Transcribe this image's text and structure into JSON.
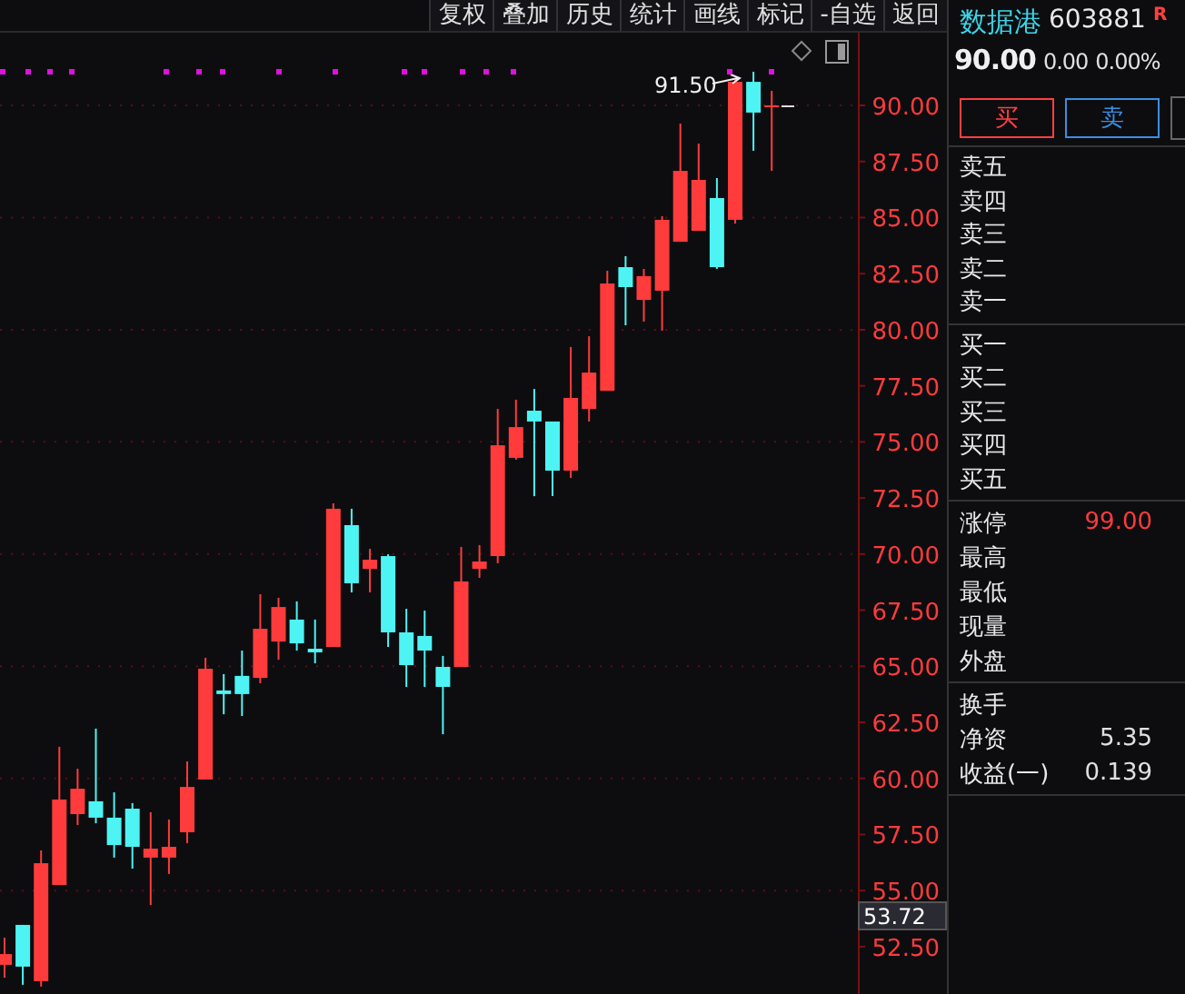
{
  "toolbar": {
    "buttons": [
      "复权",
      "叠加",
      "历史",
      "统计",
      "画线",
      "标记",
      "-自选",
      "返回"
    ]
  },
  "chart": {
    "high_marker": "91.50",
    "cursor_price": "53.72",
    "chart_data": {
      "type": "candlestick",
      "ylim": [
        50.39,
        93.24
      ],
      "grid": true,
      "yticks": [
        {
          "value": 90,
          "label": "90.00"
        },
        {
          "value": 87.5,
          "label": "87.50"
        },
        {
          "value": 85,
          "label": "85.00"
        },
        {
          "value": 82.5,
          "label": "82.50"
        },
        {
          "value": 80,
          "label": "80.00"
        },
        {
          "value": 77.5,
          "label": "77.50"
        },
        {
          "value": 75,
          "label": "75.00"
        },
        {
          "value": 72.5,
          "label": "72.50"
        },
        {
          "value": 70,
          "label": "70.00"
        },
        {
          "value": 67.5,
          "label": "67.50"
        },
        {
          "value": 65,
          "label": "65.00"
        },
        {
          "value": 62.5,
          "label": "62.50"
        },
        {
          "value": 60,
          "label": "60.00"
        },
        {
          "value": 57.5,
          "label": "57.50"
        },
        {
          "value": 55,
          "label": "55.00"
        },
        {
          "value": 52.5,
          "label": "52.50"
        }
      ],
      "ohlc": [
        [
          51.69,
          52.9,
          51.12,
          52.17
        ],
        [
          53.47,
          53.47,
          50.8,
          51.61
        ],
        [
          50.96,
          56.79,
          50.72,
          56.22
        ],
        [
          55.25,
          61.41,
          55.25,
          59.06
        ],
        [
          58.41,
          60.43,
          57.92,
          59.54
        ],
        [
          58.98,
          62.22,
          58.0,
          58.25
        ],
        [
          58.25,
          59.38,
          56.47,
          57.03
        ],
        [
          58.65,
          58.9,
          55.98,
          56.95
        ],
        [
          56.47,
          58.49,
          54.36,
          56.87
        ],
        [
          56.47,
          58.17,
          55.74,
          56.95
        ],
        [
          57.6,
          60.76,
          57.11,
          59.62
        ],
        [
          59.95,
          65.38,
          59.95,
          64.89
        ],
        [
          63.92,
          64.65,
          62.86,
          63.76
        ],
        [
          64.57,
          65.7,
          62.78,
          63.76
        ],
        [
          64.48,
          68.21,
          64.24,
          66.67
        ],
        [
          66.1,
          68.05,
          65.29,
          67.64
        ],
        [
          67.08,
          67.89,
          65.7,
          66.02
        ],
        [
          65.78,
          67.08,
          65.13,
          65.62
        ],
        [
          65.86,
          72.26,
          65.86,
          72.02
        ],
        [
          71.29,
          72.02,
          68.29,
          68.7
        ],
        [
          69.34,
          70.24,
          68.29,
          69.75
        ],
        [
          69.91,
          69.99,
          65.86,
          66.51
        ],
        [
          66.51,
          67.56,
          64.08,
          65.05
        ],
        [
          66.35,
          67.48,
          64.08,
          65.7
        ],
        [
          64.97,
          65.46,
          61.97,
          64.08
        ],
        [
          64.97,
          70.32,
          64.97,
          68.78
        ],
        [
          69.34,
          70.4,
          68.94,
          69.67
        ],
        [
          69.91,
          76.47,
          69.59,
          74.85
        ],
        [
          74.29,
          76.88,
          74.21,
          75.66
        ],
        [
          76.39,
          77.36,
          72.58,
          75.91
        ],
        [
          75.91,
          75.91,
          72.58,
          73.72
        ],
        [
          73.72,
          79.23,
          73.39,
          76.96
        ],
        [
          76.47,
          79.71,
          75.91,
          78.09
        ],
        [
          77.28,
          82.63,
          77.28,
          82.06
        ],
        [
          82.79,
          83.28,
          80.2,
          81.9
        ],
        [
          81.33,
          82.71,
          80.36,
          82.39
        ],
        [
          81.74,
          85.06,
          79.96,
          84.9
        ],
        [
          83.92,
          89.19,
          83.92,
          87.08
        ],
        [
          84.41,
          88.3,
          84.41,
          86.68
        ],
        [
          85.87,
          86.76,
          82.71,
          82.79
        ],
        [
          84.9,
          91.22,
          84.73,
          91.05
        ],
        [
          91.05,
          91.5,
          87.98,
          89.68
        ],
        [
          90.0,
          90.65,
          87.08,
          90.0
        ]
      ]
    }
  },
  "quote": {
    "name": "数据港",
    "code": "603881",
    "badge": "R",
    "price": "90.00",
    "change": "0.00",
    "change_pct": "0.00%"
  },
  "trade_buttons": [
    {
      "label": "买",
      "kind": "buy"
    },
    {
      "label": "卖",
      "kind": "sell"
    }
  ],
  "order_book": {
    "asks": [
      "卖五",
      "卖四",
      "卖三",
      "卖二",
      "卖一"
    ],
    "bids": [
      "买一",
      "买二",
      "买三",
      "买四",
      "买五"
    ]
  },
  "stats": [
    {
      "label": "涨停",
      "value": "99.00",
      "kind": "up"
    },
    {
      "label": "最高"
    },
    {
      "label": "最低"
    },
    {
      "label": "现量"
    },
    {
      "label": "外盘"
    }
  ],
  "stats_2": [
    {
      "label": "换手"
    },
    {
      "label": "净资",
      "value": "5.35",
      "kind": "plain"
    },
    {
      "label": "收益(一)",
      "value": "0.139",
      "kind": "plain"
    }
  ]
}
